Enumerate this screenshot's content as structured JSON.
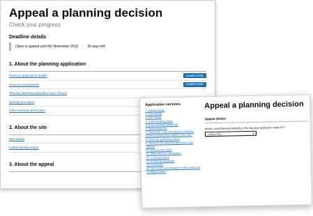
{
  "progress": {
    "title": "Appeal a planning decision",
    "subtitle": "Check your progress",
    "deadline": {
      "heading": "Deadline details",
      "open_text": "Open to appeal until 6th November 2018",
      "days_left": "30 days left"
    },
    "sections": [
      {
        "heading": "1.  About the planning application",
        "items": [
          {
            "label": "Planning application details",
            "status": "COMPLETED"
          },
          {
            "label": "Environmental details",
            "status": "COMPLETED"
          },
          {
            "label": "Why the planning application was refused",
            "status": ""
          },
          {
            "label": "Upload your plans",
            "status": ""
          },
          {
            "label": "Other relevant information",
            "status": ""
          }
        ]
      },
      {
        "heading": "2.  About the site",
        "items": [
          {
            "label": "Site details",
            "status": ""
          },
          {
            "label": "Listed building status",
            "status": ""
          }
        ]
      },
      {
        "heading": "3.  About the appeal",
        "items": []
      }
    ]
  },
  "form": {
    "nav_heading": "Application sections",
    "nav_items": [
      "1. Appeal details",
      "2. Your details",
      "3. Site Details",
      "4. Listed building status",
      "5. Environmental statement",
      "6. Appeal grounds",
      "7. Have you, or do you intend to submit a planning appeal that relates to this site?",
      "8. Planning application detail",
      "9. Reasons the planning application was refused",
      "10. Upload your plans",
      "11. Other relevant information",
      "12. Cost application",
      "13. Preferred procedure",
      "14. Ownership",
      "15. You must read and agree to the terms and conditions below"
    ],
    "title": "Appeal a planning decision",
    "section_heading": "Appeal details",
    "question": "Which Local Planning Authority (LPA) did your application relate to?*",
    "select_value": "- Select LPA -"
  }
}
